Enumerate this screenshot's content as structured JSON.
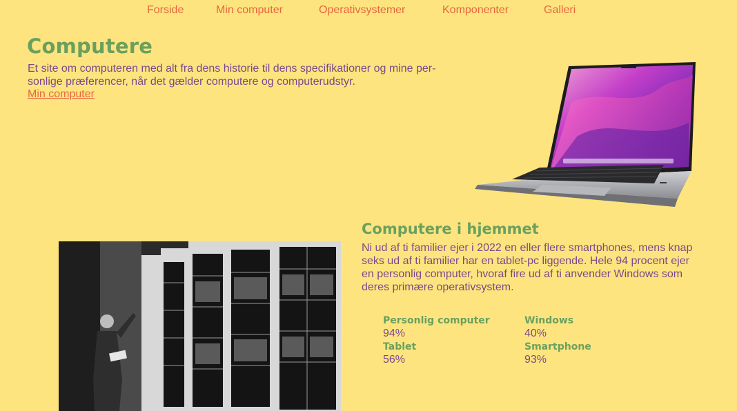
{
  "nav": {
    "items": [
      {
        "label": "Forside"
      },
      {
        "label": "Min computer"
      },
      {
        "label": "Operativsystemer"
      },
      {
        "label": "Komponenter"
      },
      {
        "label": "Galleri"
      }
    ]
  },
  "hero": {
    "title": "Computere",
    "text": "Et site om computeren med alt fra dens historie til dens specifikationer og mine per-sonlige præferencer, når det gælder computere og computerudstyr.",
    "link": "Min computer"
  },
  "section": {
    "title": "Computere i hjemmet",
    "text": "Ni ud af ti familier ejer i 2022 en eller flere smartphones, mens knap seks ud af ti familier har en tablet-pc liggende. Hele 94 procent ejer en personlig computer, hvoraf fire ud af ti anvender Windows som deres primære operativsystem."
  },
  "stats": [
    {
      "label": "Personlig computer",
      "value": "94%"
    },
    {
      "label": "Windows",
      "value": "40%"
    },
    {
      "label": "Tablet",
      "value": "56%"
    },
    {
      "label": "Smartphone",
      "value": "93%"
    }
  ],
  "colors": {
    "background": "#fde47f",
    "heading": "#6aa05e",
    "link": "#e8663d",
    "text": "#7a4a8a"
  }
}
